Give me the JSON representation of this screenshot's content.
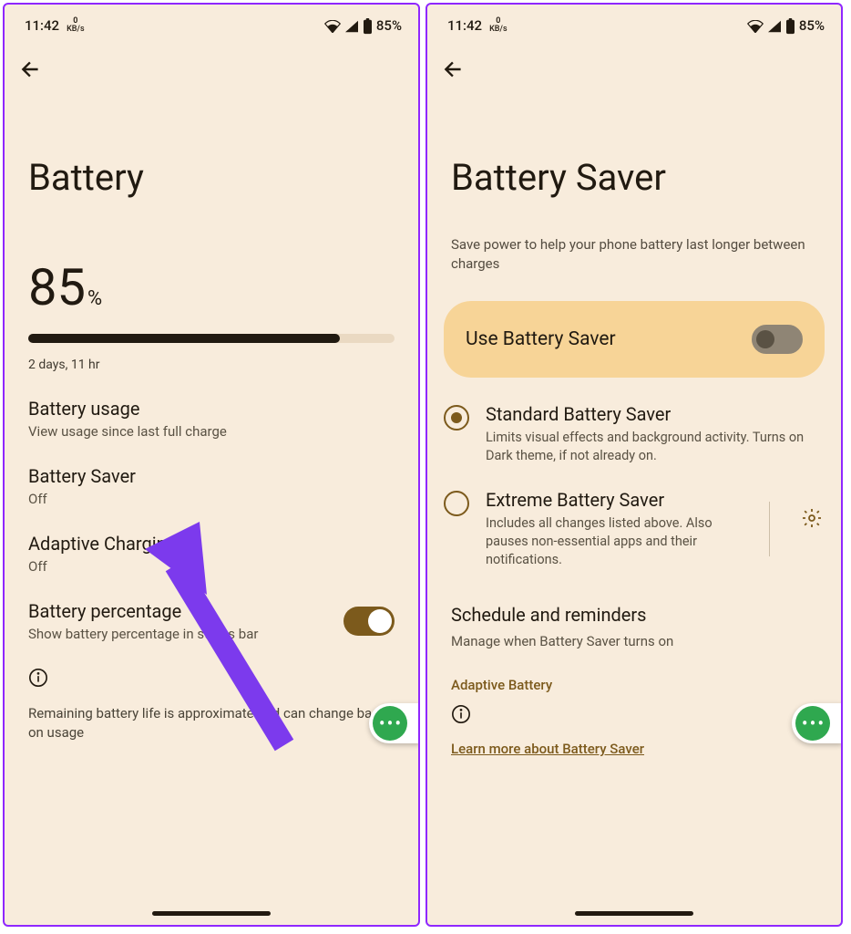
{
  "status": {
    "time": "11:42",
    "net": "0",
    "net_unit": "KB/s",
    "battery": "85%"
  },
  "left": {
    "title": "Battery",
    "pct": "85",
    "pct_sym": "%",
    "remaining": "2 days, 11 hr",
    "items": {
      "usage": {
        "t": "Battery usage",
        "s": "View usage since last full charge"
      },
      "saver": {
        "t": "Battery Saver",
        "s": "Off"
      },
      "adaptive": {
        "t": "Adaptive Charging",
        "s": "Off"
      },
      "percent": {
        "t": "Battery percentage",
        "s": "Show battery percentage in status bar"
      }
    },
    "info": "Remaining battery life is approximate and can change based on usage"
  },
  "right": {
    "title": "Battery Saver",
    "subtitle": "Save power to help your phone battery last longer between charges",
    "card_label": "Use Battery Saver",
    "standard": {
      "t": "Standard Battery Saver",
      "s": "Limits visual effects and background activity. Turns on Dark theme, if not already on."
    },
    "extreme": {
      "t": "Extreme Battery Saver",
      "s": "Includes all changes listed above. Also pauses non-essential apps and their notifications."
    },
    "schedule": {
      "t": "Schedule and reminders",
      "s": "Manage when Battery Saver turns on"
    },
    "adaptive": "Adaptive Battery",
    "learn": "Learn more about Battery Saver"
  }
}
